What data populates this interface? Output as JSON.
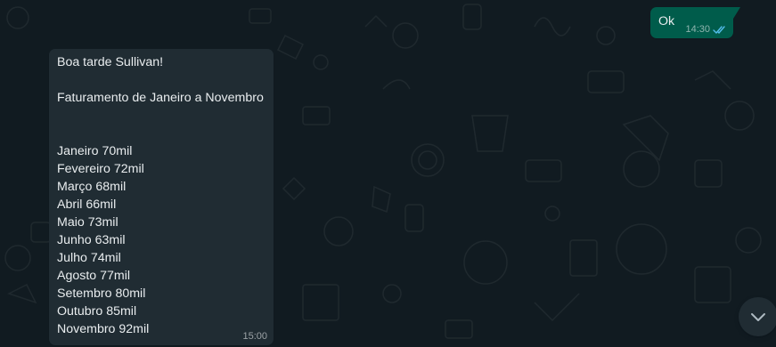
{
  "outgoing_message": {
    "text": "Ok",
    "time": "14:30",
    "status_icon": "double-check-read-icon"
  },
  "incoming_message": {
    "lines": [
      "Boa tarde Sullivan!",
      "",
      "Faturamento de Janeiro a Novembro",
      "",
      "",
      "Janeiro 70mil",
      "Fevereiro 72mil",
      "Março 68mil",
      "Abril 66mil",
      "Maio 73mil",
      "Junho 63mil",
      "Julho 74mil",
      "Agosto 77mil",
      "Setembro 80mil",
      "Outubro 85mil",
      "Novembro 92mil"
    ],
    "time": "15:00"
  },
  "scroll_button": {
    "icon": "chevron-down-icon"
  },
  "colors": {
    "chat_background": "#111b21",
    "outgoing_bubble": "#005c4b",
    "incoming_bubble": "#202c33",
    "read_check": "#53bdeb",
    "text": "#e9edef"
  }
}
